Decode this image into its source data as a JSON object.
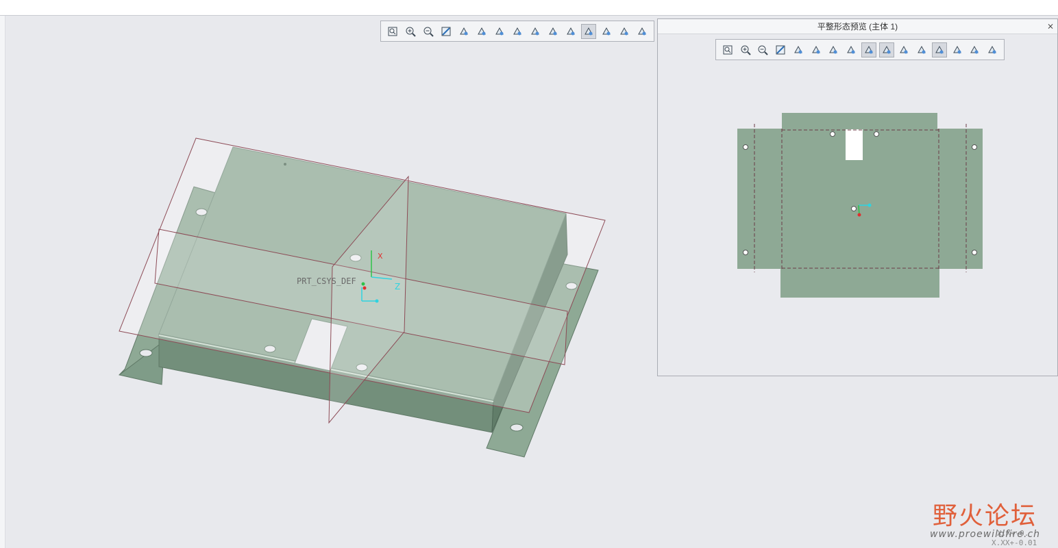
{
  "main_toolbar": {
    "buttons": [
      "refit-icon",
      "zoom-in-icon",
      "zoom-out-icon",
      "repaint-icon",
      "display-style-icon",
      "saved-orientations-icon",
      "named-views-icon",
      "spin-center-icon",
      "view-manager-icon",
      "datum-display-filter-icon",
      "annotation-display-icon",
      "csys-display-icon",
      "planes-display-icon",
      "points-display-icon",
      "sections-icon"
    ]
  },
  "flat_preview": {
    "title": "平整形态预览 (主体 1)",
    "close_label": "x",
    "buttons": [
      "refit-icon",
      "zoom-in-icon",
      "zoom-out-icon",
      "repaint-icon",
      "display-style-icon",
      "saved-orientations-icon",
      "view-manager-icon",
      "datum-display-filter-icon",
      "axes-display-icon",
      "csys-display-icon",
      "annotation-display-icon",
      "bend-lines-icon",
      "fixed-geometry-icon",
      "dimensions-icon",
      "export-icon",
      "copy-icon"
    ]
  },
  "model": {
    "csys_label": "PRT_CSYS_DEF",
    "axis_x": "X",
    "axis_z": "Z"
  },
  "watermark": {
    "title": "野火论坛",
    "url": "www.proewildfire.ch",
    "overlay_text_1": "X.X+-0.",
    "overlay_text_2": "X.XX+-0.01"
  },
  "colors": {
    "sheet_face": "#8ea995",
    "sheet_side": "#6e8b76",
    "datum_plane": "#8c4a55",
    "background": "#e8e9ed"
  }
}
